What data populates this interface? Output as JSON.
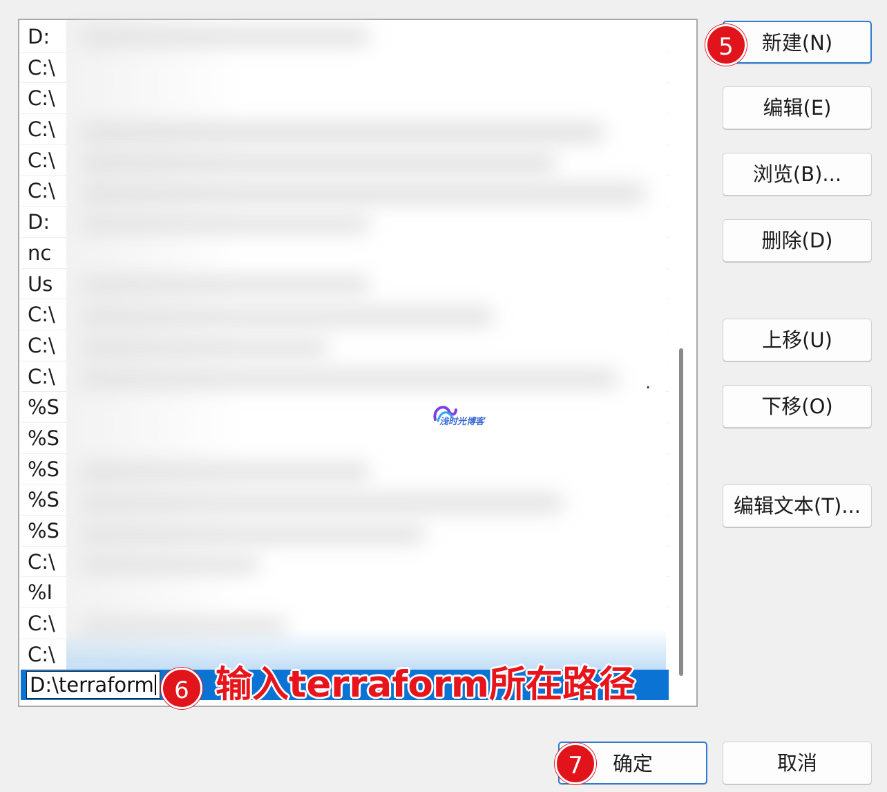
{
  "path_list": {
    "rows": [
      "D:",
      "C:\\",
      "C:\\",
      "C:\\",
      "C:\\",
      "C:\\",
      "D:",
      "nc",
      "Us",
      "C:\\",
      "C:\\",
      "C:\\",
      "%S",
      "%S",
      "%S",
      "%S",
      "%S",
      "C:\\",
      "%I",
      "C:\\",
      "C:\\"
    ],
    "editing_value": "D:\\terraform",
    "row_trailing_mark": "."
  },
  "buttons": {
    "new": "新建(N)",
    "edit": "编辑(E)",
    "browse": "浏览(B)...",
    "delete": "删除(D)",
    "move_up": "上移(U)",
    "move_down": "下移(O)",
    "edit_text": "编辑文本(T)...",
    "ok": "确定",
    "cancel": "取消"
  },
  "annotations": {
    "step5": "5",
    "step6": "6",
    "step7": "7",
    "step6_text": "输入terraform所在路径"
  },
  "watermark": {
    "text": "浅时光博客"
  },
  "colors": {
    "selection": "#0a73d4",
    "badge": "#e1141c",
    "annotation_text": "#e8141c"
  }
}
